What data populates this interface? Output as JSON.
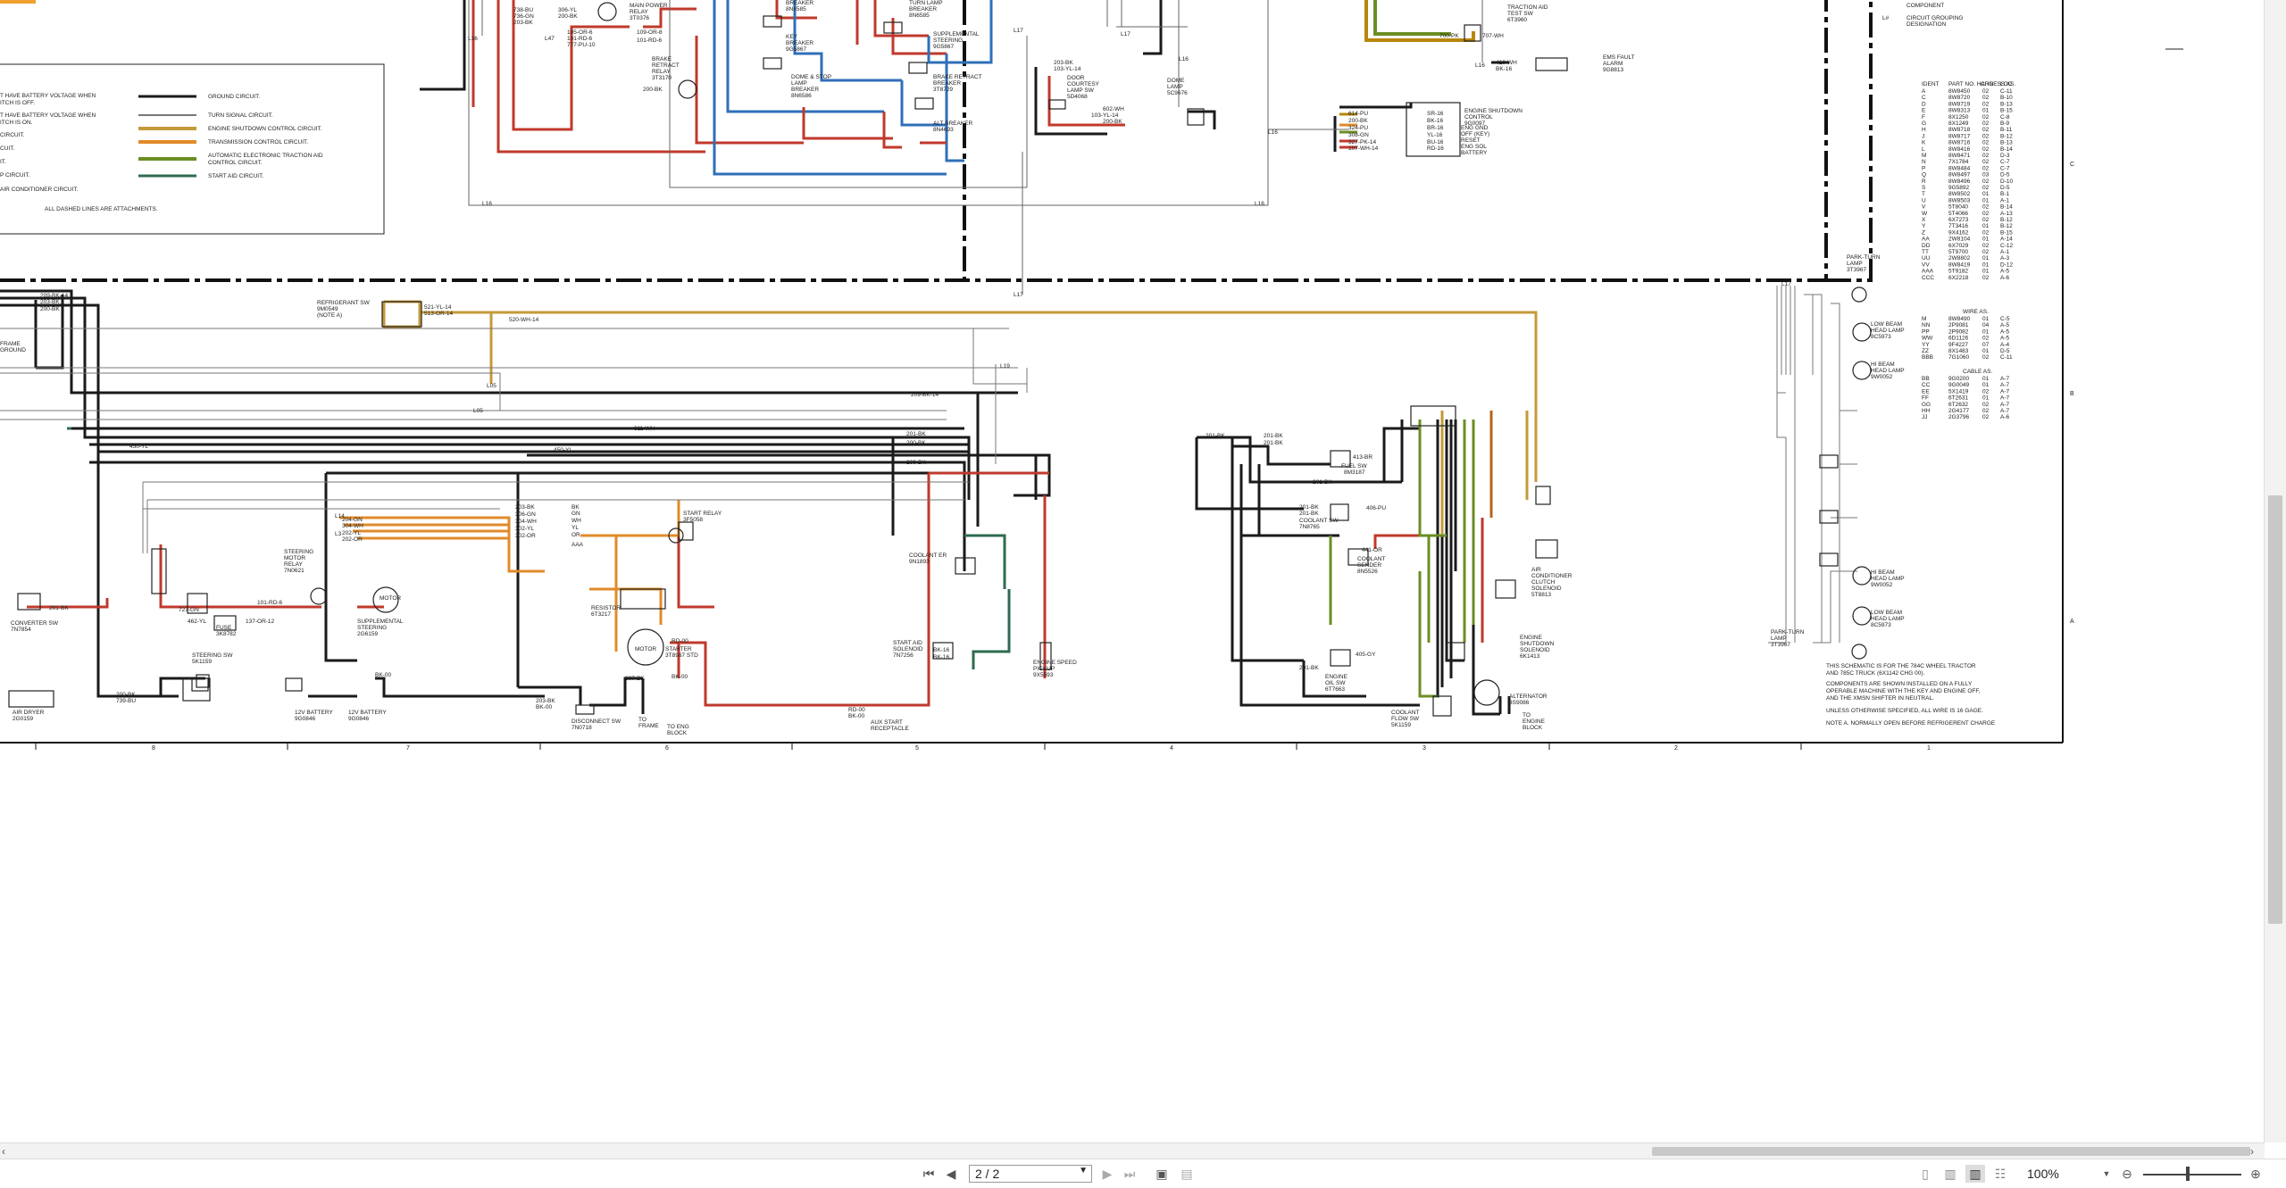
{
  "viewer": {
    "page_field": "2 / 2",
    "zoom": "100%"
  },
  "legend": {
    "lines": [
      "T HAVE BATTERY VOLTAGE WHEN",
      "ITCH IS OFF.",
      "T HAVE BATTERY VOLTAGE WHEN",
      "ITCH IS ON.",
      "CIRCUIT.",
      "CUIT.",
      "IT.",
      "P CIRCUIT.",
      "AIR CONDITIONER CIRCUIT."
    ],
    "keys": [
      "GROUND CIRCUIT.",
      "TURN SIGNAL CIRCUIT.",
      "ENGINE SHUTDOWN CONTROL CIRCUIT.",
      "TRANSMISSION CONTROL CIRCUIT.",
      "AUTOMATIC ELECTRONIC TRACTION AID",
      "CONTROL CIRCUIT.",
      "START AID CIRCUIT."
    ],
    "dashed_note": "ALL DASHED LINES ARE ATTACHMENTS."
  },
  "components": {
    "main_power_relay": "MAIN POWER",
    "main_power_relay_2": "RELAY",
    "main_power_relay_pn": "3T0376",
    "breaker": "BREAKER",
    "breaker_pn": "8N6585",
    "key_breaker": "KEY",
    "key_breaker_2": "BREAKER",
    "key_breaker_pn": "9G5867",
    "turn_lamp_breaker": "TURN LAMP",
    "turn_lamp_breaker_2": "BREAKER",
    "turn_lamp_breaker_pn": "8N6585",
    "supp_steering": "SUPPLEMENTAL",
    "supp_steering_2": "STEERING",
    "supp_steering_pn": "9G5867",
    "dome_stop_breaker": "DOME & STOP",
    "dome_stop_breaker_2": "LAMP",
    "dome_stop_breaker_3": "BREAKER",
    "dome_stop_breaker_pn": "8N6586",
    "brake_retract_breaker": "BRAKE RETRACT",
    "brake_retract_breaker_2": "BREAKER",
    "brake_retract_breaker_pn": "3T8729",
    "alt_breaker": "ALT BREAKER",
    "alt_breaker_pn": "8N4693",
    "brake_retract_relay": "BRAKE",
    "brake_retract_relay_2": "RETRACT",
    "brake_retract_relay_3": "RELAY",
    "brake_retract_relay_pn": "3T3170",
    "door_courtesy": "DOOR",
    "door_courtesy_2": "COURTESY",
    "door_courtesy_3": "LAMP SW",
    "door_courtesy_pn": "5D4068",
    "dome_lamp": "DOME",
    "dome_lamp_2": "LAMP",
    "dome_lamp_pn": "5C9676",
    "traction_aid": "TRACTION AID",
    "traction_aid_2": "TEST SW",
    "traction_aid_pn": "6T3960",
    "ems_fault": "EMS FAULT",
    "ems_fault_2": "ALARM",
    "ems_fault_pn": "9G8813",
    "engine_shutdown_control": "ENGINE SHUTDOWN",
    "engine_shutdown_control_2": "CONTROL",
    "engine_shutdown_control_pn": "9G0097",
    "refrigerant_sw": "REFRIGERANT SW",
    "refrigerant_sw_pn": "9M0549",
    "refrigerant_sw_note": "(NOTE A)",
    "start_relay": "START RELAY",
    "start_relay_pn": "3F5058",
    "resistor": "RESISTOR",
    "resistor_pn": "6T3217",
    "motor": "MOTOR",
    "starter": "STARTER",
    "starter_pn": "3T8967 STD",
    "steering_motor_relay": "STEERING",
    "steering_motor_relay_2": "MOTOR",
    "steering_motor_relay_3": "RELAY",
    "steering_motor_relay_pn": "7N0621",
    "supp_steering_motor": "SUPPLEMENTAL",
    "supp_steering_motor_2": "STEERING",
    "supp_steering_motor_pn": "2G6159",
    "converter_sw": "CONVERTER SW",
    "converter_sw_pn": "7N7854",
    "fuse": "FUSE",
    "fuse_pn": "3K8782",
    "steering_sw": "STEERING SW",
    "steering_sw_pn": "5K1159",
    "air_dryer": "AIR DRYER",
    "air_dryer_pn": "2G0159",
    "battery_1": "12V BATTERY",
    "battery_1_pn": "9G0846",
    "battery_2": "12V BATTERY",
    "battery_2_pn": "9G0846",
    "disconnect_sw": "DISCONNECT SW",
    "disconnect_sw_pn": "7N0718",
    "to_frame": "TO",
    "to_frame_2": "FRAME",
    "to_eng_block": "TO ENG",
    "to_eng_block_2": "BLOCK",
    "aux_start": "AUX START",
    "aux_start_2": "RECEPTACLE",
    "coolant_er": "COOLANT ER",
    "coolant_er_pn": "9N1893",
    "start_aid_sol": "START AID",
    "start_aid_sol_2": "SOLENOID",
    "start_aid_sol_pn": "7N7256",
    "engine_speed": "ENGINE SPEED",
    "engine_speed_2": "PICKUP",
    "engine_speed_pn": "9X5593",
    "fuel_sw": "FUEL SW",
    "fuel_sw_pn": "8M3187",
    "coolant_sw": "COOLANT SW",
    "coolant_sw_pn": "7N8765",
    "coolant_sender": "COOLANT",
    "coolant_sender_2": "SENDER",
    "coolant_sender_pn": "8N5526",
    "engine_oil_sw": "ENGINE",
    "engine_oil_sw_2": "OIL SW",
    "engine_oil_sw_pn": "6T7663",
    "coolant_flow": "COOLANT",
    "coolant_flow_2": "FLOW SW",
    "coolant_flow_pn": "5K1159",
    "alternator": "ALTERNATOR",
    "alternator_pn": "3S9086",
    "to_engine_block": "TO",
    "to_engine_block_2": "ENGINE",
    "to_engine_block_3": "BLOCK",
    "ac_clutch": "AIR",
    "ac_clutch_2": "CONDITIONER",
    "ac_clutch_3": "CLUTCH",
    "ac_clutch_4": "SOLENOID",
    "ac_clutch_pn": "5T8813",
    "engine_shutdown_sol": "ENGINE",
    "engine_shutdown_sol_2": "SHUTDOWN",
    "engine_shutdown_sol_3": "SOLENOID",
    "engine_shutdown_sol_pn": "6K1413",
    "frame_ground": "FRAME",
    "frame_ground_2": "GROUND",
    "park_turn_top": "PARK-TURN",
    "park_turn_top_2": "LAMP",
    "park_turn_top_pn": "3T3967",
    "low_beam_1": "LOW BEAM",
    "low_beam_1_2": "HEAD LAMP",
    "low_beam_1_pn": "8C5973",
    "hi_beam_1": "HI BEAM",
    "hi_beam_1_2": "HEAD LAMP",
    "hi_beam_1_pn": "9W0052",
    "hi_beam_2": "HI BEAM",
    "hi_beam_2_2": "HEAD LAMP",
    "hi_beam_2_pn": "9W0052",
    "low_beam_2": "LOW BEAM",
    "low_beam_2_2": "HEAD LAMP",
    "low_beam_2_pn": "8C5973",
    "park_turn_bot": "PARK-TURN",
    "park_turn_bot_2": "LAMP",
    "park_turn_bot_pn": "3T3967"
  },
  "esc_labels": [
    "ENG GND",
    "OFF (KEY)",
    "RESET",
    "ENG SOL",
    "BATTERY"
  ],
  "esc_wires": [
    "614-PU",
    "200-BK",
    "324-PU",
    "308-GN",
    "327-PK-14",
    "107-WH-14"
  ],
  "esc_pins": [
    "SR-16",
    "BK-16",
    "BR-16",
    "YL-16",
    "BU-16",
    "RD-16"
  ],
  "grid_cols": [
    "8",
    "7",
    "6",
    "5",
    "4",
    "3",
    "2",
    "1"
  ],
  "grid_rows": [
    "C",
    "B",
    "A"
  ],
  "key_table": {
    "top_label": "COMPONENT",
    "key_letter": "L#",
    "key_desc_1": "CIRCUIT GROUPING",
    "key_desc_2": "DESIGNATION",
    "header": [
      "IDENT",
      "PART NO. HARNESS AS.",
      "CHG",
      "LOC"
    ],
    "rows": [
      [
        "A",
        "8W8450",
        "02",
        "C-11"
      ],
      [
        "C",
        "8W8720",
        "02",
        "B-10"
      ],
      [
        "D",
        "8W8719",
        "02",
        "B-13"
      ],
      [
        "E",
        "8W8313",
        "01",
        "B-15"
      ],
      [
        "F",
        "8X1250",
        "02",
        "C-8"
      ],
      [
        "G",
        "8X1249",
        "02",
        "B-9"
      ],
      [
        "H",
        "8W8718",
        "02",
        "B-11"
      ],
      [
        "J",
        "8W8717",
        "02",
        "B-12"
      ],
      [
        "K",
        "8W8716",
        "02",
        "B-13"
      ],
      [
        "L",
        "8W8416",
        "02",
        "B-14"
      ],
      [
        "M",
        "8W8471",
        "02",
        "D-3"
      ],
      [
        "N",
        "7X1784",
        "02",
        "C-7"
      ],
      [
        "P",
        "8W8484",
        "02",
        "C-7"
      ],
      [
        "Q",
        "8W8497",
        "03",
        "D-5"
      ],
      [
        "R",
        "8W8496",
        "02",
        "D-10"
      ],
      [
        "S",
        "9G5892",
        "02",
        "D-5"
      ],
      [
        "T",
        "8W8502",
        "01",
        "B-1"
      ],
      [
        "U",
        "8W8503",
        "01",
        "A-1"
      ],
      [
        "V",
        "5T8040",
        "02",
        "B-14"
      ],
      [
        "W",
        "5T4066",
        "02",
        "A-13"
      ],
      [
        "X",
        "6X7273",
        "02",
        "B-12"
      ],
      [
        "Y",
        "7T3416",
        "01",
        "B-12"
      ],
      [
        "Z",
        "9X4162",
        "02",
        "B-15"
      ],
      [
        "AA",
        "2W8104",
        "01",
        "A-14"
      ],
      [
        "DD",
        "6X7029",
        "02",
        "C-12"
      ],
      [
        "TT",
        "5T9700",
        "02",
        "A-1"
      ],
      [
        "UU",
        "2W8802",
        "01",
        "A-3"
      ],
      [
        "VV",
        "8W8419",
        "01",
        "D-12"
      ],
      [
        "AAA",
        "5T9182",
        "01",
        "A-5"
      ],
      [
        "CCC",
        "6X2218",
        "02",
        "A-6"
      ]
    ],
    "wire_as": "WIRE AS.",
    "wire_rows": [
      [
        "M",
        "8W8490",
        "01",
        "C-5"
      ],
      [
        "NN",
        "2P9081",
        "04",
        "A-5"
      ],
      [
        "PP",
        "2P9082",
        "01",
        "A-5"
      ],
      [
        "WW",
        "6D1126",
        "02",
        "A-5"
      ],
      [
        "YY",
        "9F4227",
        "07",
        "A-4"
      ],
      [
        "ZZ",
        "8X1483",
        "01",
        "D-5"
      ],
      [
        "BBB",
        "7G1060",
        "02",
        "C-11"
      ]
    ],
    "cable_as": "CABLE AS.",
    "cable_rows": [
      [
        "BB",
        "9G0200",
        "01",
        "A-7"
      ],
      [
        "CC",
        "9G0049",
        "01",
        "A-7"
      ],
      [
        "EE",
        "5X1419",
        "02",
        "A-7"
      ],
      [
        "FF",
        "6T2631",
        "01",
        "A-7"
      ],
      [
        "GG",
        "6T2632",
        "02",
        "A-7"
      ],
      [
        "HH",
        "2G4177",
        "02",
        "A-7"
      ],
      [
        "JJ",
        "2G3796",
        "02",
        "A-6"
      ]
    ]
  },
  "notes": [
    "THIS SCHEMATIC IS FOR THE 784C WHEEL TRACTOR",
    "AND 785C TRUCK (6X1142 CHG 00).",
    "",
    "COMPONENTS ARE SHOWN INSTALLED ON A FULLY",
    "OPERABLE MACHINE WITH THE KEY AND ENGINE OFF,",
    "AND THE XMSN SHIFTER IN NEUTRAL.",
    "",
    "UNLESS OTHERWISE SPECIFIED, ALL WIRE IS 16 GAGE.",
    "",
    "NOTE A. NORMALLY OPEN BEFORE REFRIGERENT CHARGE"
  ],
  "colors": {
    "ground": "#1a1a1a",
    "turn_signal": "#555555",
    "engine_shutdown": "#b8860b",
    "transmission": "#e08b2a",
    "traction_aid": "#6b8e23",
    "start_aid": "#2e6b4f",
    "red": "#c0392b",
    "blue": "#2f6fb8",
    "viewer_accent": "#f0a030"
  }
}
